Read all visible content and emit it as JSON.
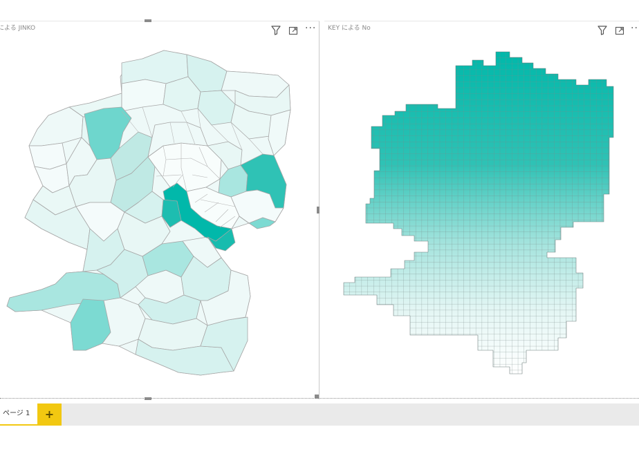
{
  "visuals": {
    "left": {
      "title": "による JINKO"
    },
    "right": {
      "title": "KEY による No"
    }
  },
  "icons": {
    "filter": "filter-icon",
    "focus": "focus-mode-icon",
    "more": "more-options-icon",
    "add": "plus-icon"
  },
  "colors": {
    "accent": "#01b8aa",
    "page_tab_accent": "#f2c811",
    "tab_bar": "#eaeaea"
  },
  "more_label": "···",
  "pages": {
    "tabs": [
      {
        "label": "ページ 1"
      }
    ],
    "add_label": "+"
  }
}
